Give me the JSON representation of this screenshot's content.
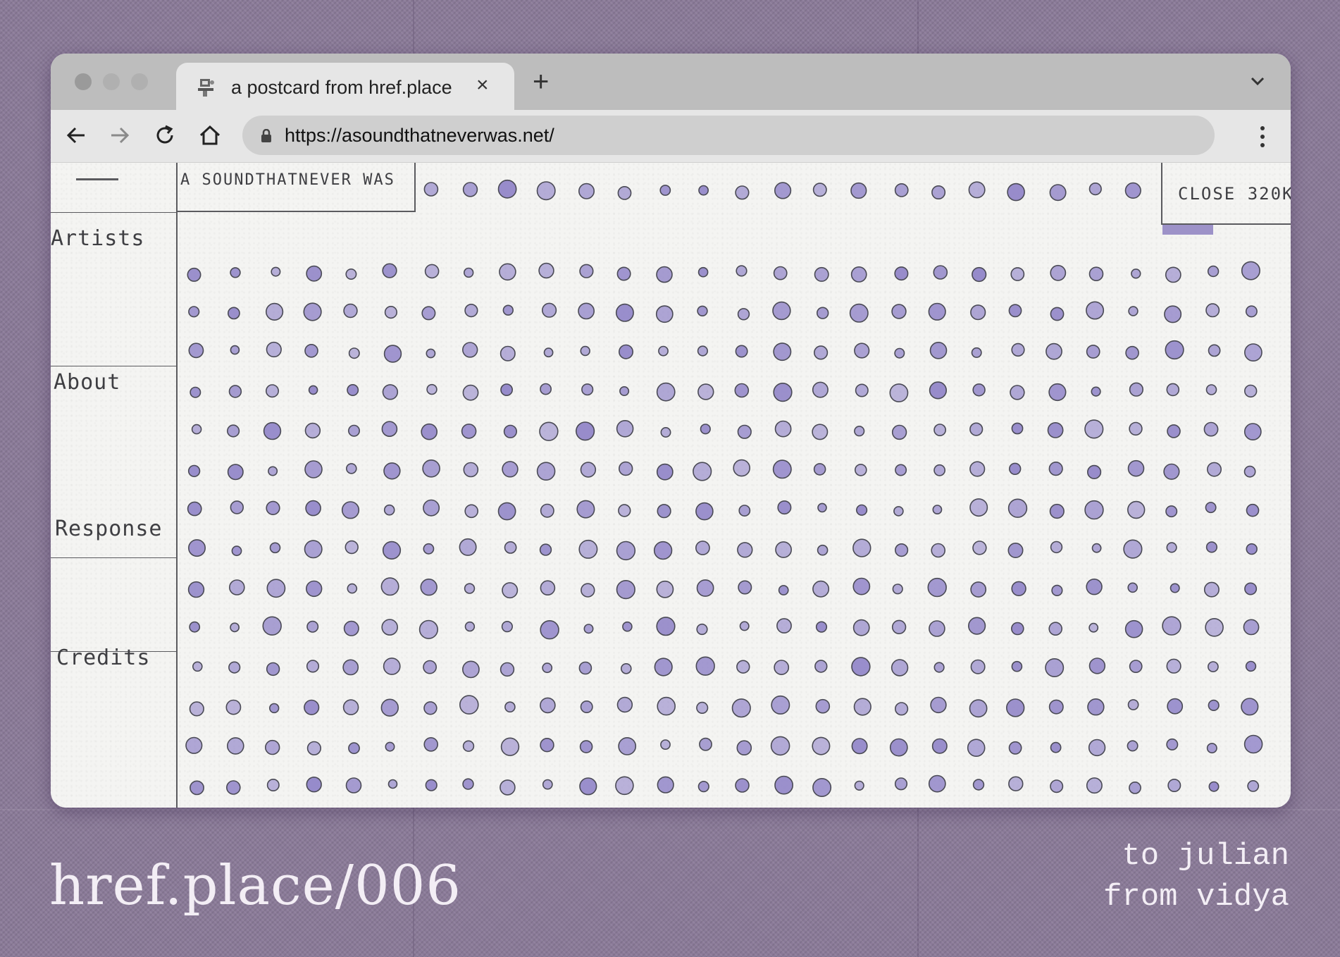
{
  "browser": {
    "tab_title": "a postcard from href.place",
    "url": "https://asoundthatneverwas.net/"
  },
  "sketch": {
    "site_title": "A SOUNDTHATNEVER WAS",
    "close_button": "CLOSE 320K",
    "nav": [
      "Artists",
      "About",
      "Response",
      "Credits"
    ],
    "dot_color": "#8c7fc6"
  },
  "postcard": {
    "code": "href.place/006",
    "to": "to julian",
    "from": "from vidya"
  },
  "colors": {
    "background": "#8a7a98",
    "ink": "#3e3e42"
  }
}
